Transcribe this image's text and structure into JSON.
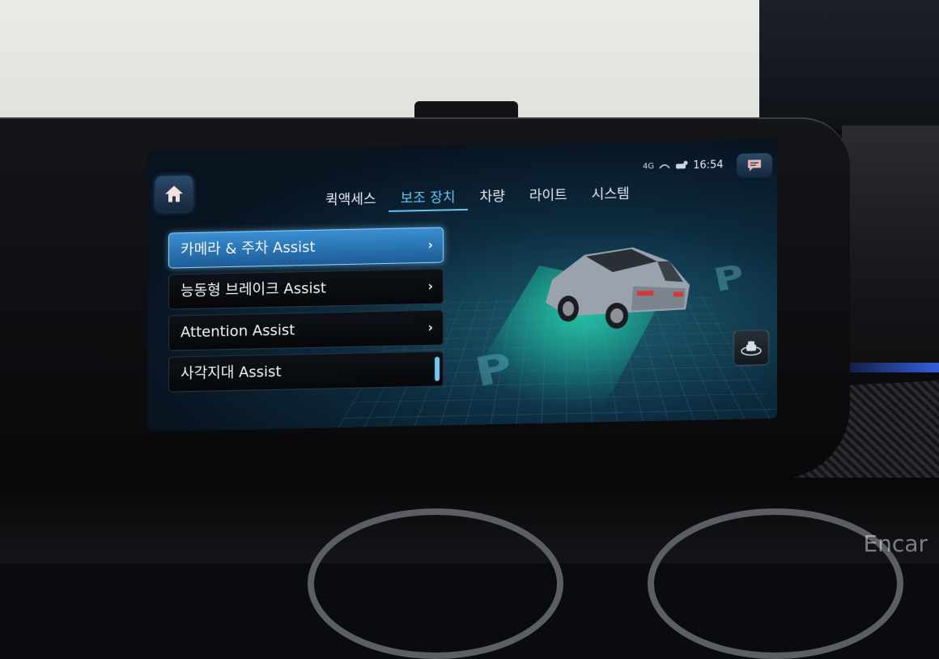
{
  "status_bar": {
    "network": "4G",
    "time": "16:54"
  },
  "tabs": [
    {
      "label": "퀵액세스",
      "active": false
    },
    {
      "label": "보조 장치",
      "active": true
    },
    {
      "label": "차량",
      "active": false
    },
    {
      "label": "라이트",
      "active": false
    },
    {
      "label": "시스템",
      "active": false
    }
  ],
  "menu": {
    "items": [
      {
        "label": "카메라 & 주차 Assist",
        "selected": true
      },
      {
        "label": "능동형 브레이크 Assist",
        "selected": false
      },
      {
        "label": "Attention Assist",
        "selected": false
      },
      {
        "label": "사각지대 Assist",
        "selected": false
      }
    ]
  },
  "illustration": {
    "parking_letter": "P",
    "view_button_icon": "360-view-icon"
  },
  "icons": {
    "home": "home-icon",
    "message": "message-icon"
  },
  "colors": {
    "accent": "#63c6f5",
    "selected_item": "#2f7dbf",
    "beam": "#28f0be"
  },
  "watermark": "Encar"
}
